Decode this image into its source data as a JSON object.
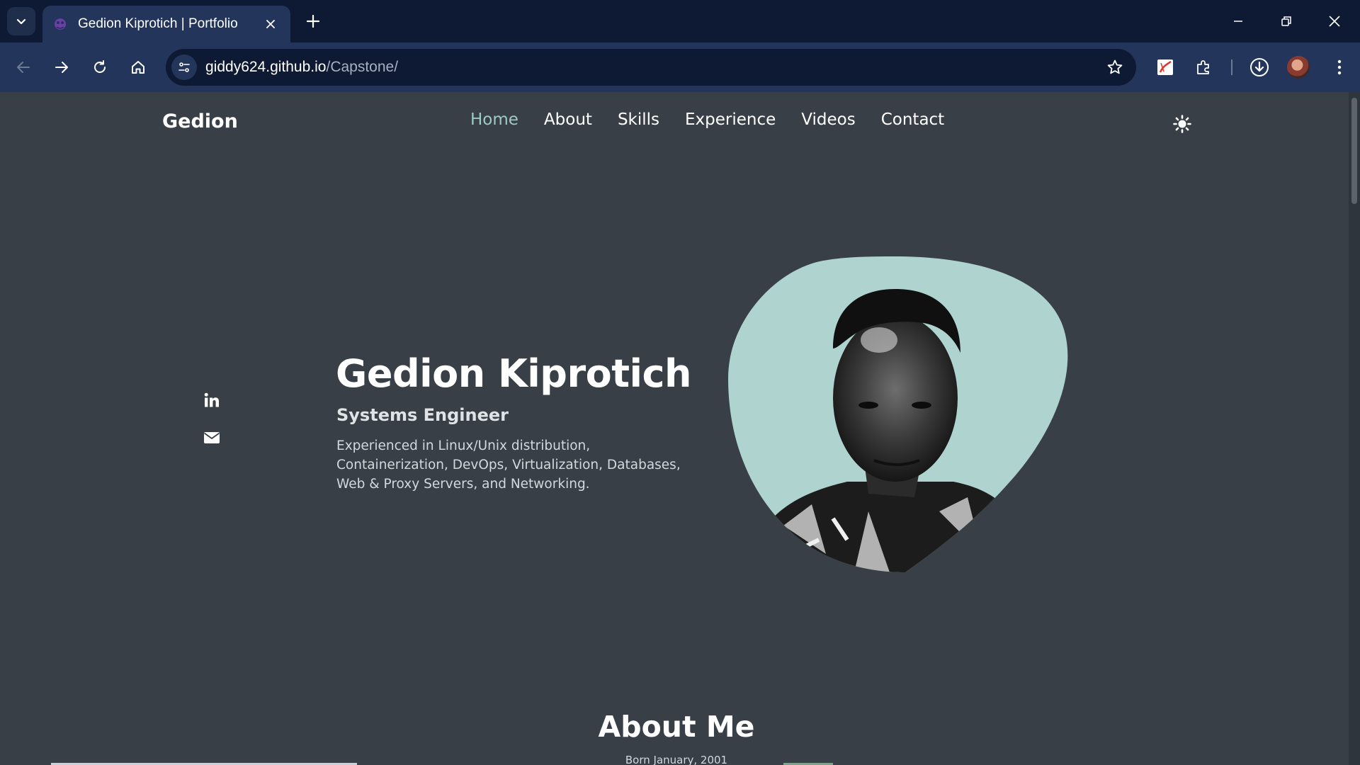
{
  "browser": {
    "tab_title": "Gedion Kiprotich | Portfolio",
    "url_host": "giddy624.github.io",
    "url_path": "/Capstone/",
    "icons": [
      "tab-list-icon",
      "favicon-icon",
      "close-icon",
      "plus-icon",
      "minimize-icon",
      "restore-icon",
      "window-close-icon",
      "back-icon",
      "forward-icon",
      "reload-icon",
      "home-icon",
      "site-info-icon",
      "star-icon",
      "pdf-extension-icon",
      "extensions-icon",
      "download-icon",
      "profile-avatar",
      "more-icon"
    ]
  },
  "nav": {
    "logo": "Gedion",
    "items": [
      "Home",
      "About",
      "Skills",
      "Experience",
      "Videos",
      "Contact"
    ],
    "active": "Home",
    "theme_icon": "sun-icon"
  },
  "social": [
    "linkedin-icon",
    "envelope-icon"
  ],
  "hero": {
    "name": "Gedion Kiprotich",
    "role": "Systems Engineer",
    "description": "Experienced in Linux/Unix distribution, Containerization, DevOps, Virtualization, Databases, Web & Proxy Servers, and Networking."
  },
  "about": {
    "title": "About Me",
    "subtitle": "Born January, 2001"
  },
  "colors": {
    "page_bg": "#393f46",
    "accent": "#9fc9c7",
    "blob": "#afd3cf",
    "tabstrip": "#0e1a33",
    "toolbar": "#23355a"
  }
}
